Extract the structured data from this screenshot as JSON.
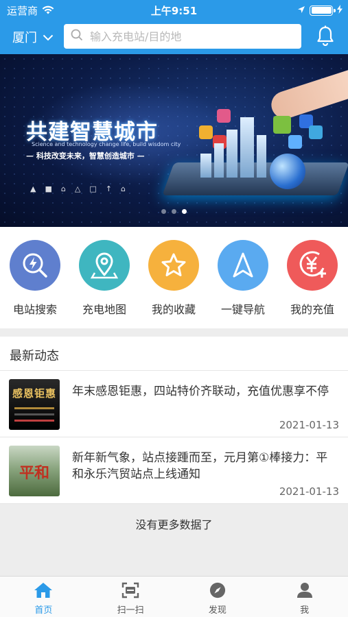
{
  "status_bar": {
    "carrier": "运营商",
    "time": "上午9:51"
  },
  "header": {
    "city": "厦门",
    "search_placeholder": "输入充电站/目的地"
  },
  "banner": {
    "title": "共建智慧城市",
    "subtitle_en": "Science and technology change life, build wisdom city",
    "subtitle_cn": "— 科技改变未来，智慧创造城市 —",
    "page_count": 3,
    "active_page": 3
  },
  "quick_actions": [
    {
      "label": "电站搜索",
      "icon": "bolt-search-icon",
      "color": "#5f7fce"
    },
    {
      "label": "充电地图",
      "icon": "map-pin-icon",
      "color": "#3fb6c0"
    },
    {
      "label": "我的收藏",
      "icon": "star-icon",
      "color": "#f6b13d"
    },
    {
      "label": "一键导航",
      "icon": "navigation-arrow-icon",
      "color": "#5aaaf0"
    },
    {
      "label": "我的充值",
      "icon": "yen-recharge-icon",
      "color": "#ef5a5a"
    }
  ],
  "news": {
    "heading": "最新动态",
    "items": [
      {
        "title": "年末感恩钜惠，四站特价齐联动，充值优惠享不停",
        "date": "2021-01-13",
        "thumb_text": "感恩钜惠"
      },
      {
        "title": "新年新气象，站点接踵而至，元月第①棒接力：平和永乐汽贸站点上线通知",
        "date": "2021-01-13",
        "thumb_text": "平和"
      }
    ]
  },
  "no_more_text": "没有更多数据了",
  "tabbar": [
    {
      "label": "首页",
      "icon": "home-icon",
      "active": true
    },
    {
      "label": "扫一扫",
      "icon": "scan-icon",
      "active": false
    },
    {
      "label": "发现",
      "icon": "compass-icon",
      "active": false
    },
    {
      "label": "我",
      "icon": "user-icon",
      "active": false
    }
  ],
  "colors": {
    "primary": "#2b9ae8",
    "background": "#ededed"
  }
}
